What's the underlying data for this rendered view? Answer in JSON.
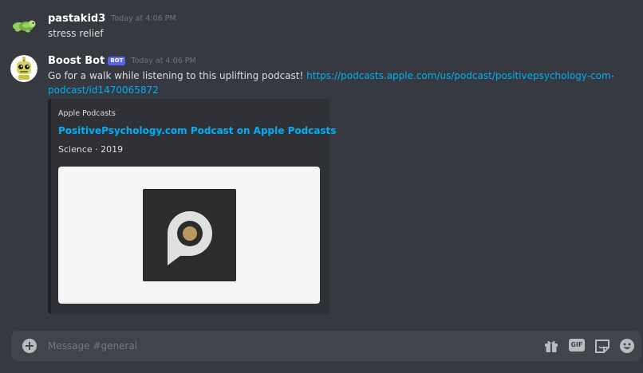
{
  "messages": [
    {
      "username": "pastakid3",
      "timestamp": "Today at 4:06 PM",
      "text": "stress relief",
      "avatar_icon": "turtle-avatar"
    },
    {
      "username": "Boost Bot",
      "bot_tag": "BOT",
      "timestamp": "Today at 4:06 PM",
      "text": "Go for a walk while listening to this uplifting podcast! ",
      "link_line1": "https://podcasts.apple.com/us/podcast/positivepsychology-com-",
      "link_line2": "podcast/id1470065872",
      "avatar_icon": "robot-avatar",
      "embed": {
        "provider": "Apple Podcasts",
        "title": "PositivePsychology.com Podcast on Apple Podcasts",
        "description": "Science · 2019",
        "image_icon": "positive-psychology-logo"
      }
    }
  ],
  "composer": {
    "placeholder": "Message #general",
    "gif_label": "GIF"
  },
  "colors": {
    "background": "#36393f",
    "link": "#00aff4",
    "bot_tag": "#5865f2",
    "composer": "#40444b",
    "embed": "#2f3136"
  }
}
